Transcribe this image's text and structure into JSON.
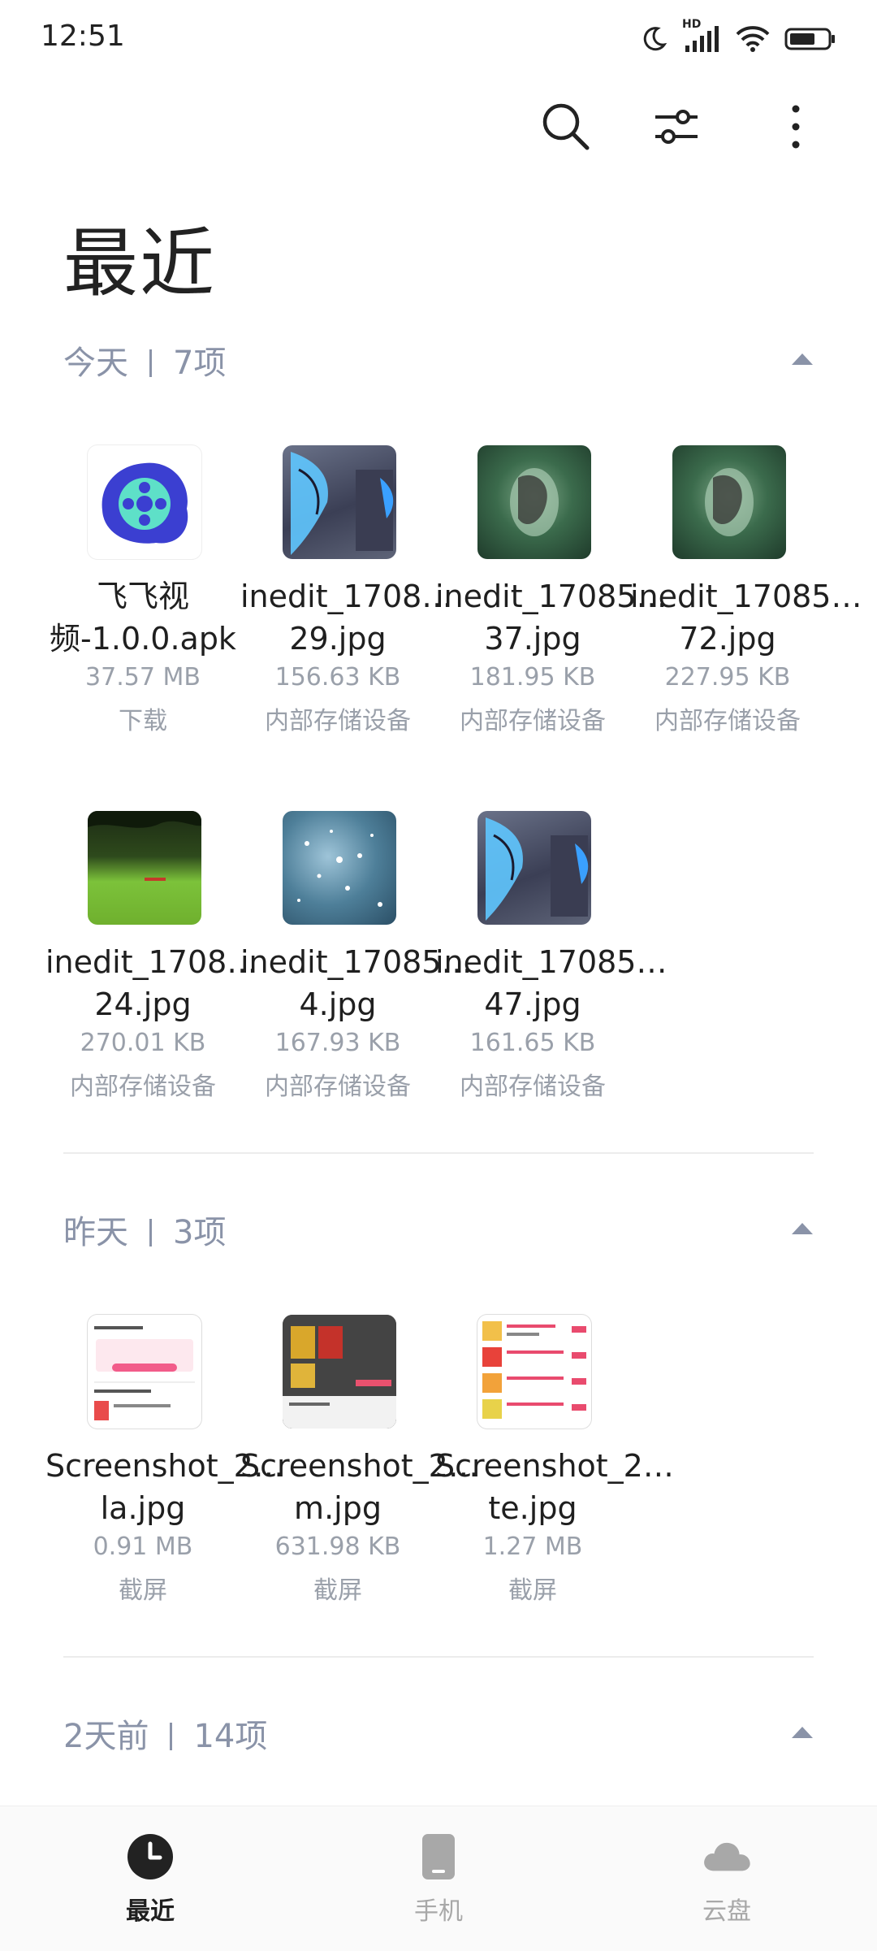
{
  "status_bar": {
    "time": "12:51",
    "hd_label": "HD"
  },
  "page": {
    "title": "最近"
  },
  "sections": [
    {
      "day": "今天",
      "count": "7项",
      "items": [
        {
          "name": "飞飞视频-1.0.0.apk",
          "size": "37.57 MB",
          "location": "下载",
          "thumb": "app-icon"
        },
        {
          "name": "inedit_1708…29.jpg",
          "size": "156.63 KB",
          "location": "内部存储设备",
          "thumb": "butterfly"
        },
        {
          "name": "inedit_17085…37.jpg",
          "size": "181.95 KB",
          "location": "内部存储设备",
          "thumb": "forest-girl"
        },
        {
          "name": "inedit_17085…72.jpg",
          "size": "227.95 KB",
          "location": "内部存储设备",
          "thumb": "forest-girl"
        },
        {
          "name": "inedit_1708…24.jpg",
          "size": "270.01 KB",
          "location": "内部存储设备",
          "thumb": "meadow"
        },
        {
          "name": "inedit_17085…4.jpg",
          "size": "167.93 KB",
          "location": "内部存储设备",
          "thumb": "sparkle"
        },
        {
          "name": "inedit_17085…47.jpg",
          "size": "161.65 KB",
          "location": "内部存储设备",
          "thumb": "butterfly"
        }
      ]
    },
    {
      "day": "昨天",
      "count": "3项",
      "items": [
        {
          "name": "Screenshot_2…la.jpg",
          "size": "0.91 MB",
          "location": "截屏",
          "thumb": "screenshot-light"
        },
        {
          "name": "Screenshot_2…m.jpg",
          "size": "631.98 KB",
          "location": "截屏",
          "thumb": "screenshot-dark"
        },
        {
          "name": "Screenshot_2…te.jpg",
          "size": "1.27 MB",
          "location": "截屏",
          "thumb": "screenshot-list"
        }
      ]
    },
    {
      "day": "2天前",
      "count": "14项",
      "items": []
    }
  ],
  "bottom_nav": [
    {
      "label": "最近",
      "icon": "clock-icon",
      "active": true
    },
    {
      "label": "手机",
      "icon": "phone-icon",
      "active": false
    },
    {
      "label": "云盘",
      "icon": "cloud-icon",
      "active": false
    }
  ],
  "colors": {
    "accent_gray": "#8a93a8",
    "app_icon_blue": "#3b3fd1",
    "app_icon_teal": "#5ee0c8"
  }
}
